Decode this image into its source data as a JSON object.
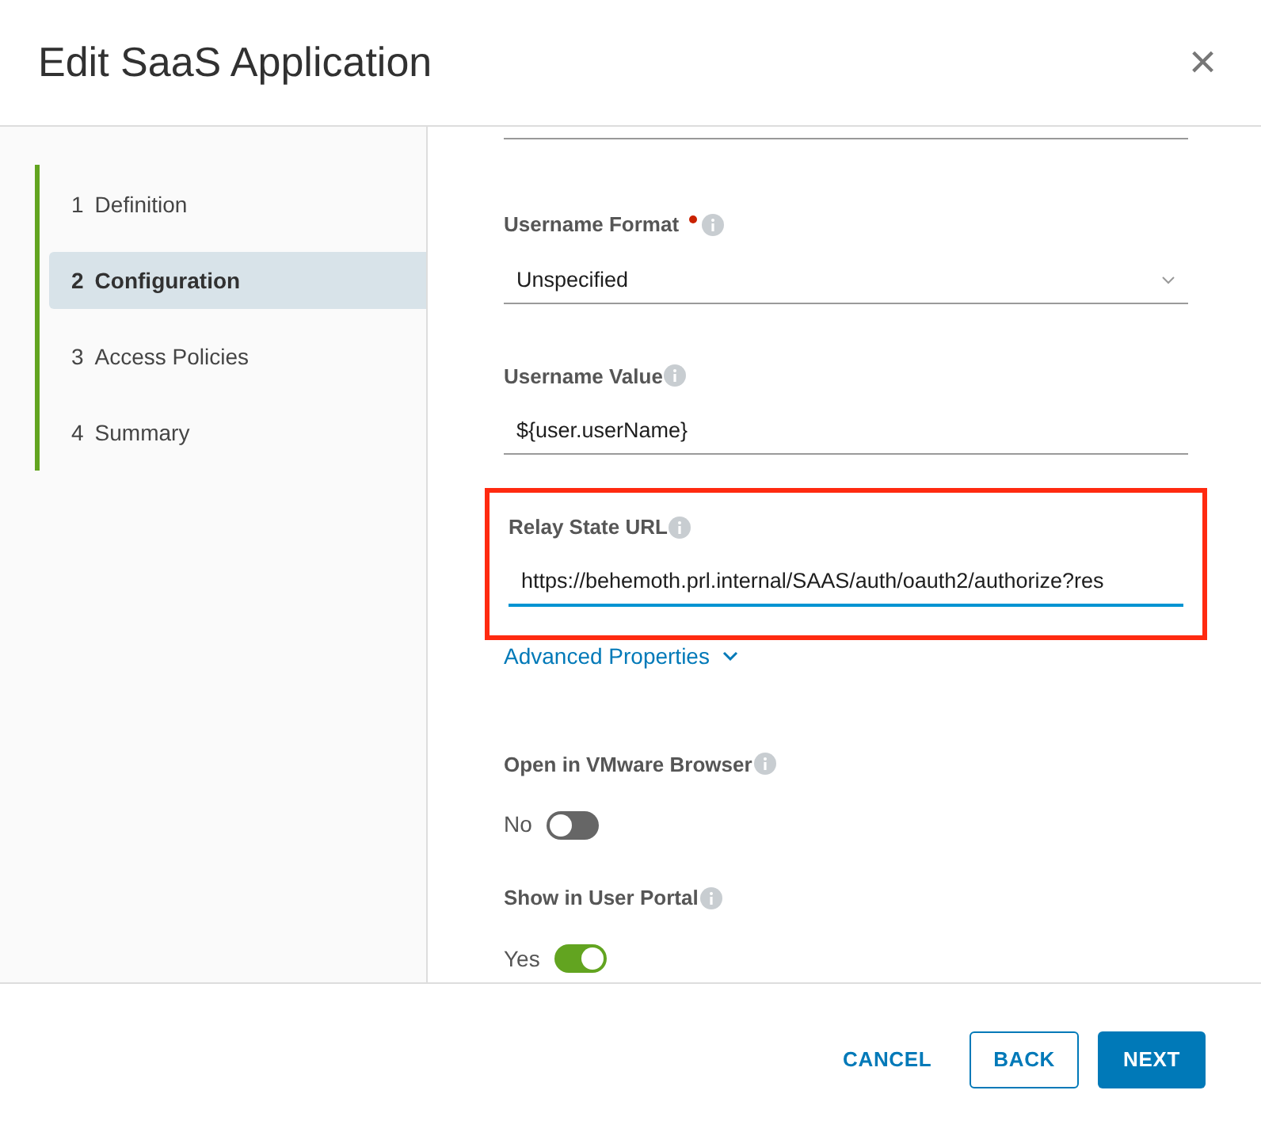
{
  "dialog": {
    "title": "Edit SaaS Application",
    "close": "×"
  },
  "steps": [
    {
      "number": "1",
      "label": "Definition",
      "selected": false
    },
    {
      "number": "2",
      "label": "Configuration",
      "selected": true
    },
    {
      "number": "3",
      "label": "Access Policies",
      "selected": false
    },
    {
      "number": "4",
      "label": "Summary",
      "selected": false
    }
  ],
  "fields": [
    {
      "kind": "select",
      "label": "Username Format",
      "required": true,
      "value": "Unspecified",
      "focused": false,
      "highlighted": false
    },
    {
      "kind": "text",
      "label": "Username Value",
      "required": false,
      "value": "${user.userName}",
      "focused": false,
      "highlighted": false
    },
    {
      "kind": "text",
      "label": "Relay State URL",
      "required": false,
      "value": "https://behemoth.prl.internal/SAAS/auth/oauth2/authorize?res",
      "focused": true,
      "highlighted": true
    },
    {
      "kind": "link",
      "label": "Advanced Properties",
      "expanded": false
    },
    {
      "kind": "toggle",
      "label": "Open in VMware Browser",
      "on": false,
      "value": "No"
    },
    {
      "kind": "toggle",
      "label": "Show in User Portal",
      "on": true,
      "value": "Yes"
    }
  ],
  "buttons": [
    {
      "kind": "flat",
      "label": "CANCEL"
    },
    {
      "kind": "outline",
      "label": "BACK"
    },
    {
      "kind": "primary",
      "label": "NEXT"
    }
  ]
}
